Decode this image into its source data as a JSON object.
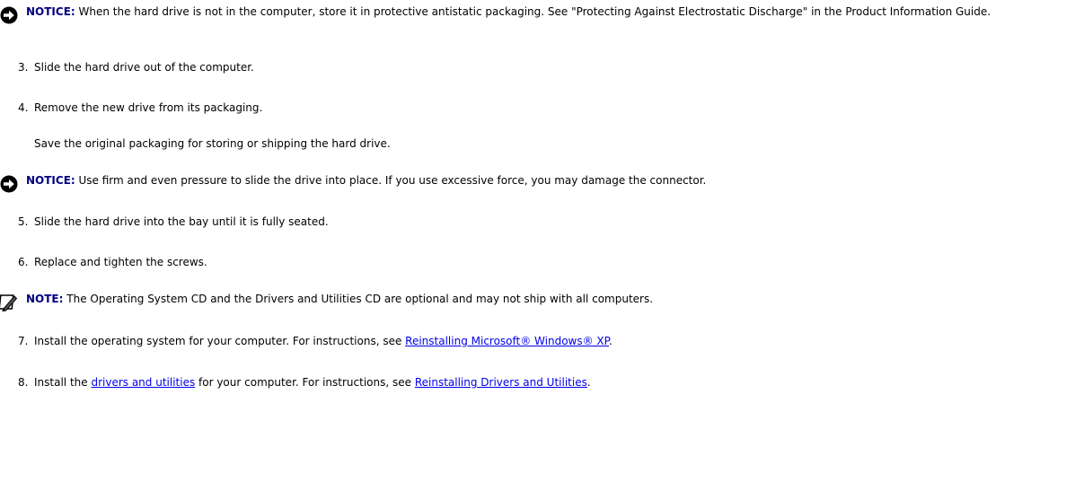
{
  "notice1": {
    "label": "NOTICE:",
    "text": " When the hard drive is not in the computer, store it in protective antistatic packaging. See \"Protecting Against Electrostatic Discharge\" in the Product Information Guide."
  },
  "step3": {
    "num": "3.",
    "text": "Slide the hard drive out of the computer."
  },
  "step4": {
    "num": "4.",
    "text": "Remove the new drive from its packaging."
  },
  "step4_note": "Save the original packaging for storing or shipping the hard drive.",
  "notice2": {
    "label": "NOTICE:",
    "text": " Use firm and even pressure to slide the drive into place. If you use excessive force, you may damage the connector."
  },
  "step5": {
    "num": "5.",
    "text": "Slide the hard drive into the bay until it is fully seated."
  },
  "step6": {
    "num": "6.",
    "text": "Replace and tighten the screws."
  },
  "note": {
    "label": "NOTE:",
    "text": " The Operating System CD and the Drivers and Utilities CD are optional and may not ship with all computers."
  },
  "step7": {
    "num": "7.",
    "text": "Install the operating system for your computer. For instructions, see ",
    "link": "Reinstalling Microsoft® Windows® XP",
    "end": "."
  },
  "step8": {
    "num": "8.",
    "text_a": "Install the ",
    "link_a": "drivers and utilities",
    "text_b": " for your computer. For instructions, see ",
    "link_b": "Reinstalling Drivers and Utilities",
    "end": "."
  },
  "colors": {
    "label": "#000080",
    "link": "#0000ee",
    "icon": "#000000"
  }
}
